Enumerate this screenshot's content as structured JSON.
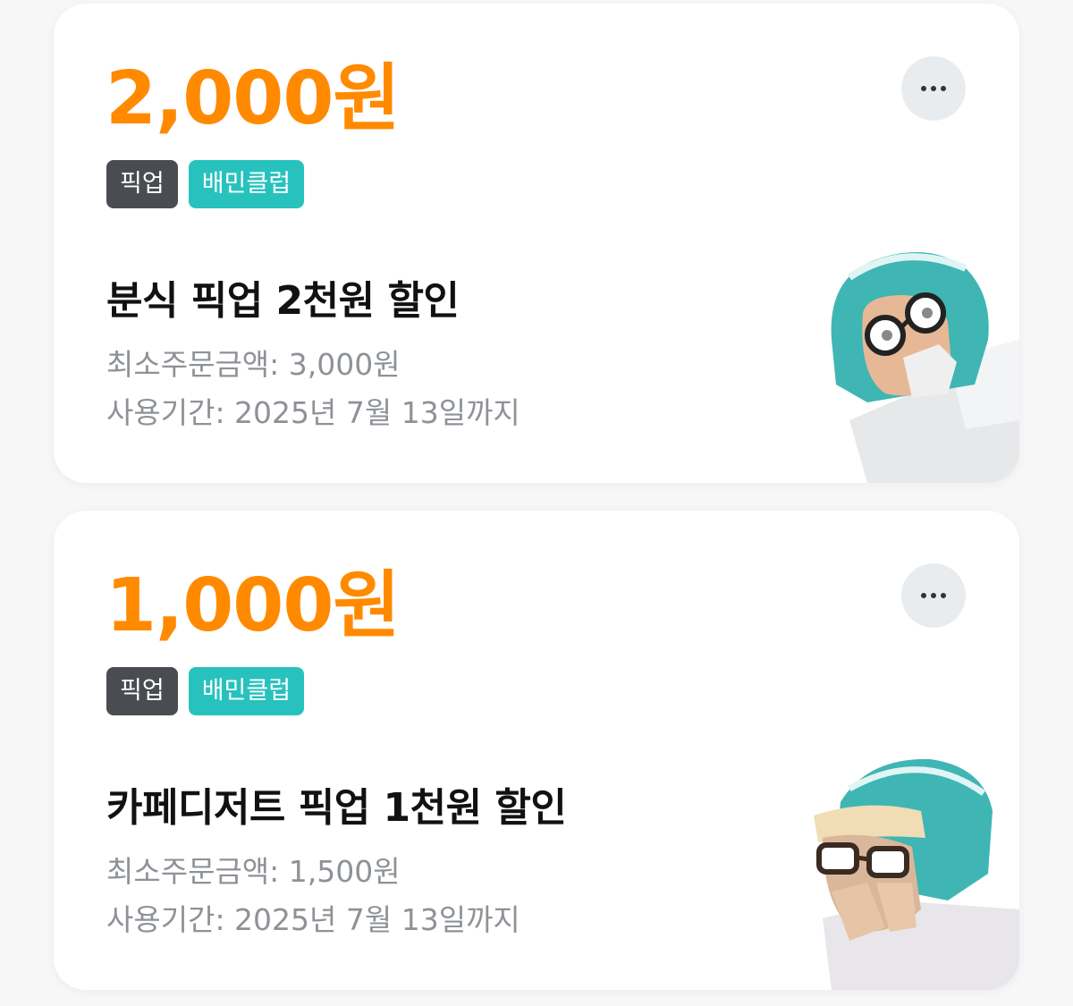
{
  "coupons": [
    {
      "amount": "2,000원",
      "tag_pickup": "픽업",
      "tag_club": "배민클럽",
      "title": "분식 픽업 2천원 할인",
      "min_order": "최소주문금액: 3,000원",
      "period": "사용기간: 2025년 7월 13일까지",
      "illustration": "character-covering-mouth-icon"
    },
    {
      "amount": "1,000원",
      "tag_pickup": "픽업",
      "tag_club": "배민클럽",
      "title": "카페디저트 픽업 1천원 할인",
      "min_order": "최소주문금액: 1,500원",
      "period": "사용기간: 2025년 7월 13일까지",
      "illustration": "character-peeking-icon"
    }
  ],
  "colors": {
    "amount": "#ff8a00",
    "tag_dark": "#494d51",
    "tag_teal": "#27c2be",
    "menu_bg": "#e9ecee"
  },
  "icons": {
    "more": "more-horizontal-icon"
  }
}
